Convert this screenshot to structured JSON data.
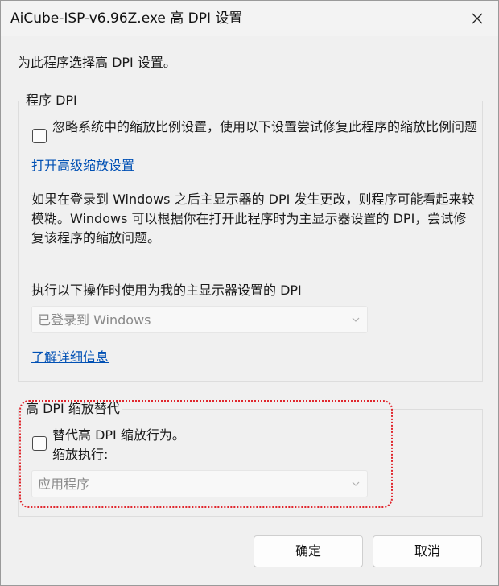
{
  "window": {
    "title": "AiCube-ISP-v6.96Z.exe 高 DPI 设置",
    "close_icon": "close-icon"
  },
  "intro": "为此程序选择高 DPI 设置。",
  "program_dpi": {
    "legend": "程序 DPI",
    "override_checkbox_label": "忽略系统中的缩放比例设置，使用以下设置尝试修复此程序的缩放比例问题",
    "override_checked": false,
    "advanced_scaling_link": "打开高级缩放设置",
    "description": "如果在登录到 Windows 之后主显示器的 DPI 发生更改，则程序可能看起来较模糊。Windows 可以根据你在打开此程序时为主显示器设置的 DPI，尝试修复该程序的缩放问题。",
    "dropdown_label": "执行以下操作时使用为我的主显示器设置的 DPI",
    "dropdown_value": "已登录到 Windows",
    "learn_more_link": "了解详细信息"
  },
  "high_dpi_override": {
    "legend": "高 DPI 缩放替代",
    "checkbox_label_line1": "替代高 DPI 缩放行为。",
    "checkbox_label_line2": "缩放执行:",
    "override_checked": false,
    "dropdown_value": "应用程序"
  },
  "buttons": {
    "ok": "确定",
    "cancel": "取消"
  },
  "colors": {
    "link": "#0050b4",
    "highlight": "#e0262d",
    "disabled_text": "#8a8a8a"
  }
}
